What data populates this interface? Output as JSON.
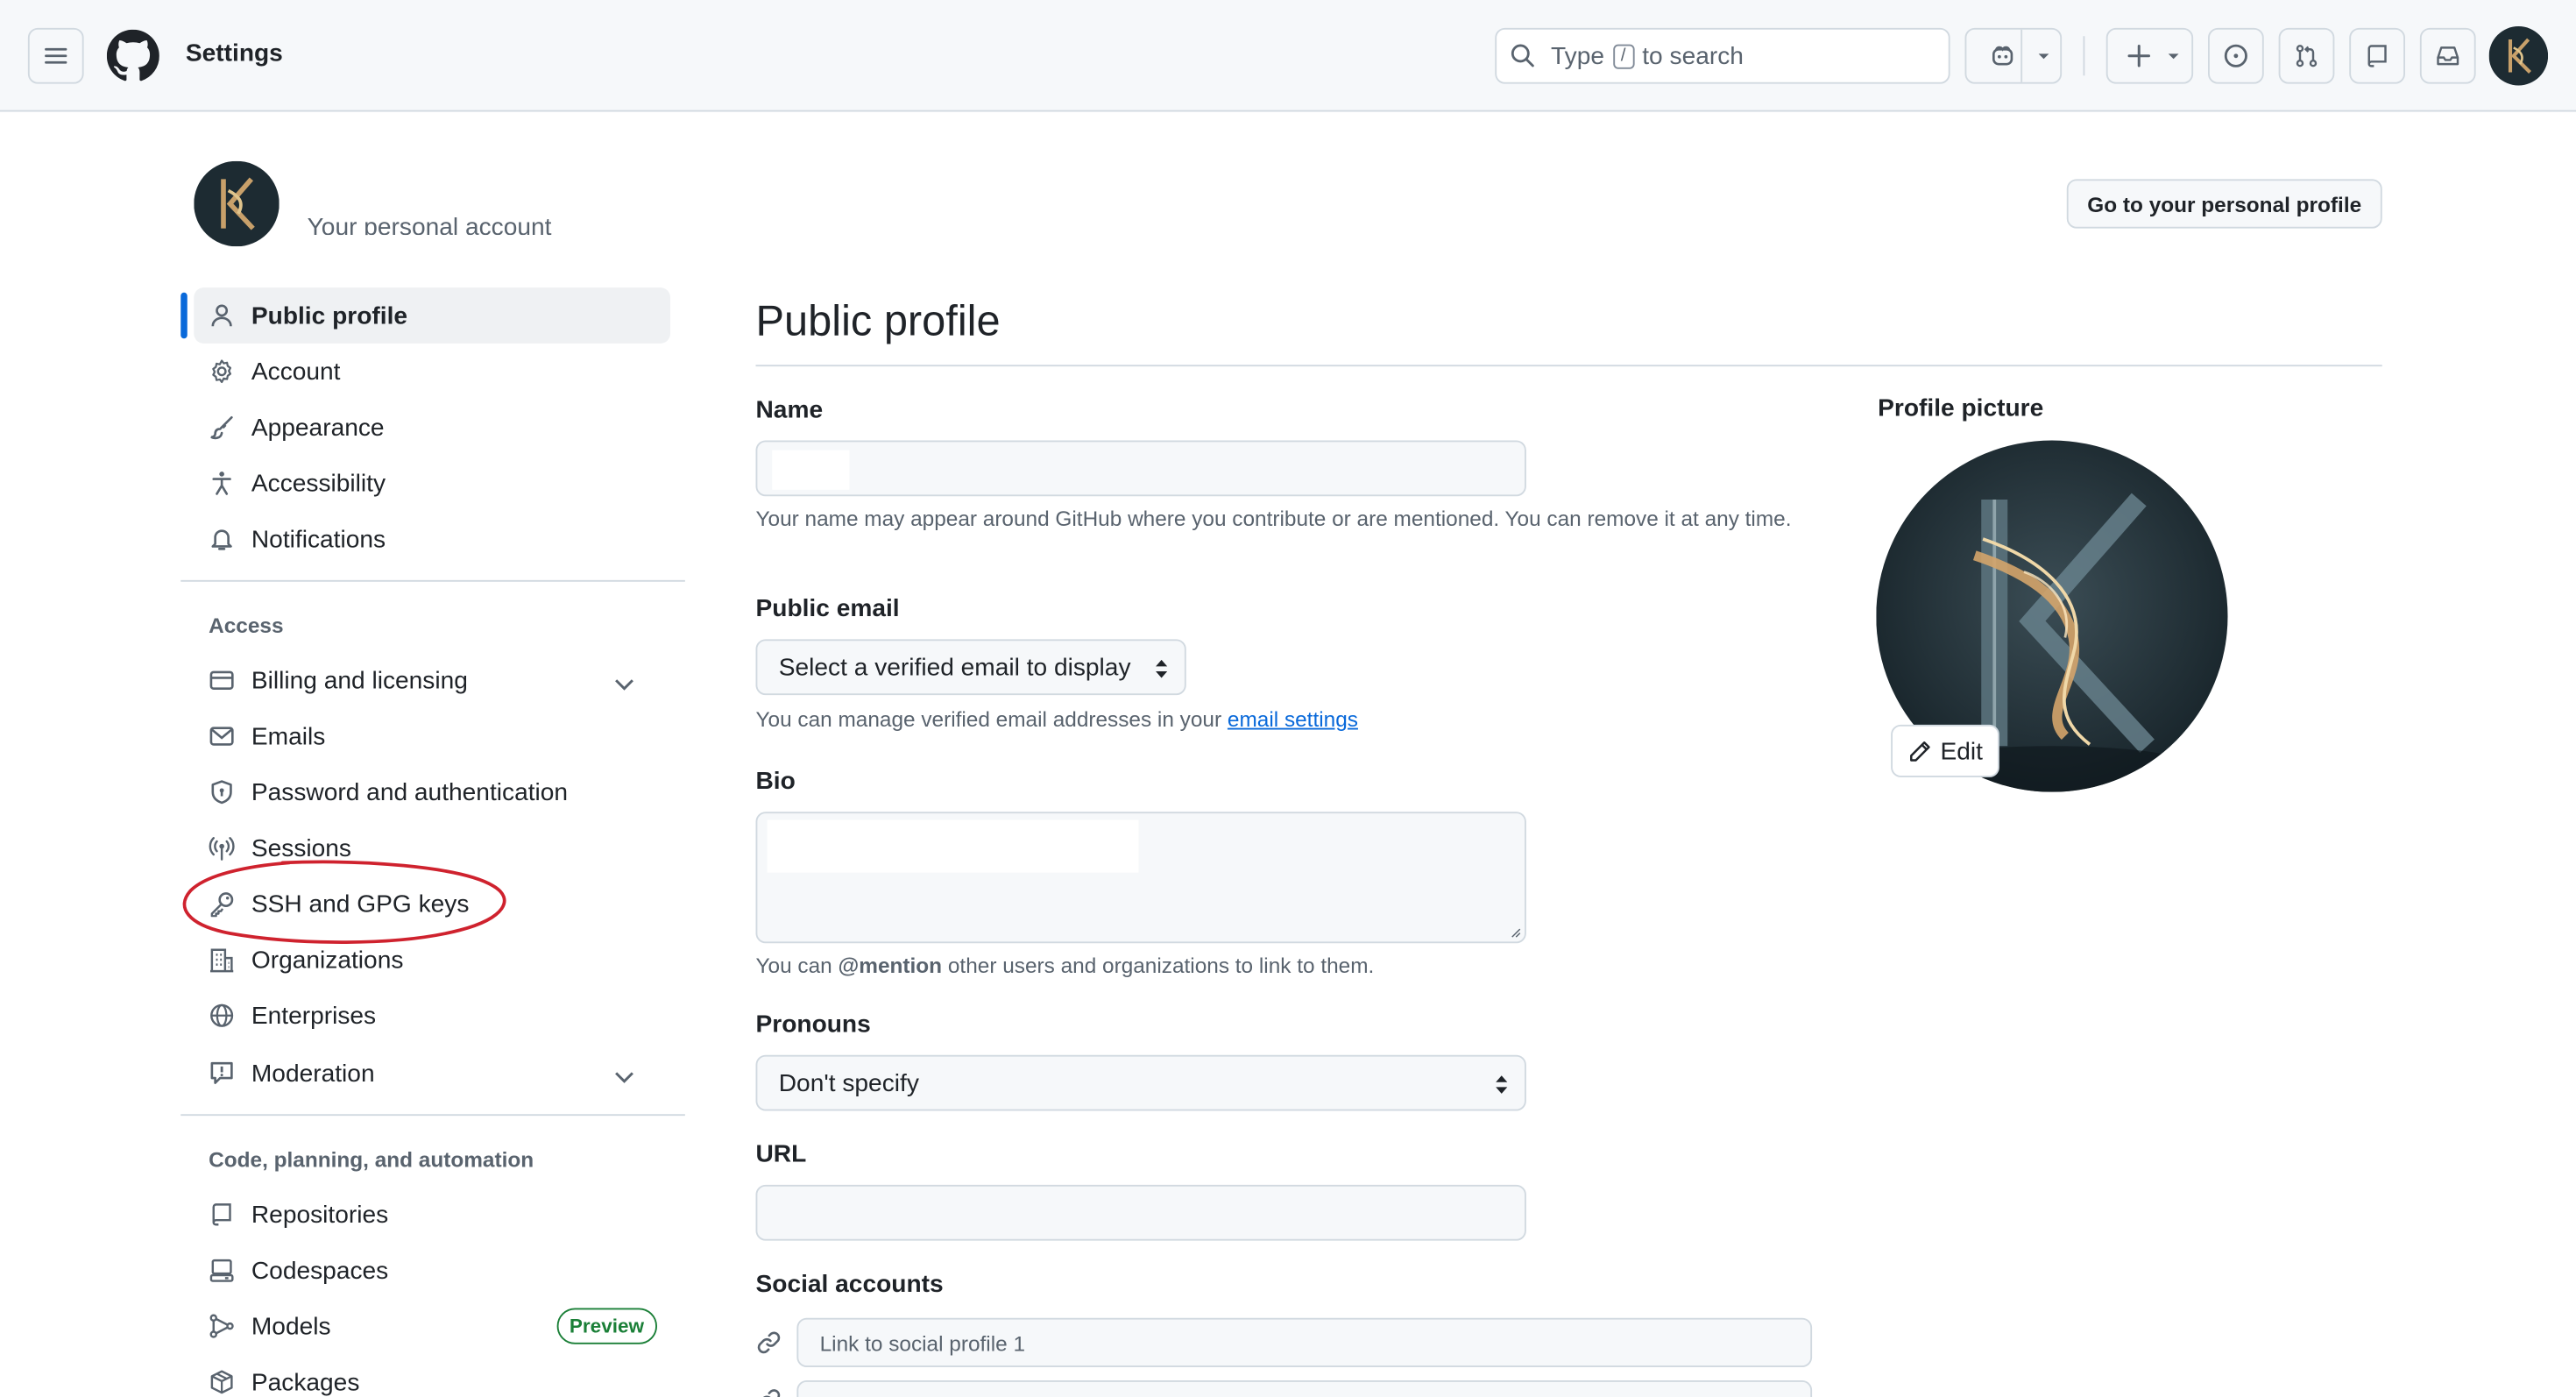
{
  "header": {
    "title": "Settings",
    "search": {
      "prefix": "Type",
      "key": "/",
      "suffix": "to search"
    }
  },
  "account": {
    "subtitle": "Your personal account",
    "go_profile_label": "Go to your personal profile"
  },
  "sidebar": {
    "top_items": [
      {
        "label": "Public profile",
        "icon": "person-icon",
        "active": true
      },
      {
        "label": "Account",
        "icon": "gear-icon"
      },
      {
        "label": "Appearance",
        "icon": "paintbrush-icon"
      },
      {
        "label": "Accessibility",
        "icon": "accessibility-icon"
      },
      {
        "label": "Notifications",
        "icon": "bell-icon"
      }
    ],
    "access_heading": "Access",
    "access_items": [
      {
        "label": "Billing and licensing",
        "icon": "credit-card-icon",
        "expandable": true
      },
      {
        "label": "Emails",
        "icon": "mail-icon"
      },
      {
        "label": "Password and authentication",
        "icon": "shield-lock-icon"
      },
      {
        "label": "Sessions",
        "icon": "broadcast-icon"
      },
      {
        "label": "SSH and GPG keys",
        "icon": "key-icon"
      },
      {
        "label": "Organizations",
        "icon": "organization-icon"
      },
      {
        "label": "Enterprises",
        "icon": "globe-icon"
      },
      {
        "label": "Moderation",
        "icon": "report-icon",
        "expandable": true
      }
    ],
    "code_heading": "Code, planning, and automation",
    "code_items": [
      {
        "label": "Repositories",
        "icon": "repo-icon"
      },
      {
        "label": "Codespaces",
        "icon": "codespaces-icon"
      },
      {
        "label": "Models",
        "icon": "models-icon",
        "badge": "Preview"
      },
      {
        "label": "Packages",
        "icon": "package-icon"
      }
    ]
  },
  "main": {
    "title": "Public profile",
    "name": {
      "label": "Name",
      "help": "Your name may appear around GitHub where you contribute or are mentioned. You can remove it at any time."
    },
    "public_email": {
      "label": "Public email",
      "selected": "Select a verified email to display",
      "help_prefix": "You can manage verified email addresses in your",
      "help_link": "email settings"
    },
    "bio": {
      "label": "Bio",
      "help_prefix": "You can",
      "help_bold": "@mention",
      "help_suffix": "other users and organizations to link to them."
    },
    "pronouns": {
      "label": "Pronouns",
      "selected": "Don't specify"
    },
    "url": {
      "label": "URL",
      "value": ""
    },
    "social": {
      "label": "Social accounts",
      "placeholder_1": "Link to social profile 1"
    }
  },
  "profile_picture": {
    "label": "Profile picture",
    "edit_label": "Edit"
  },
  "colors": {
    "accent": "#0969da",
    "annotation": "#cf222e",
    "preview_badge": "#1a7f37"
  }
}
